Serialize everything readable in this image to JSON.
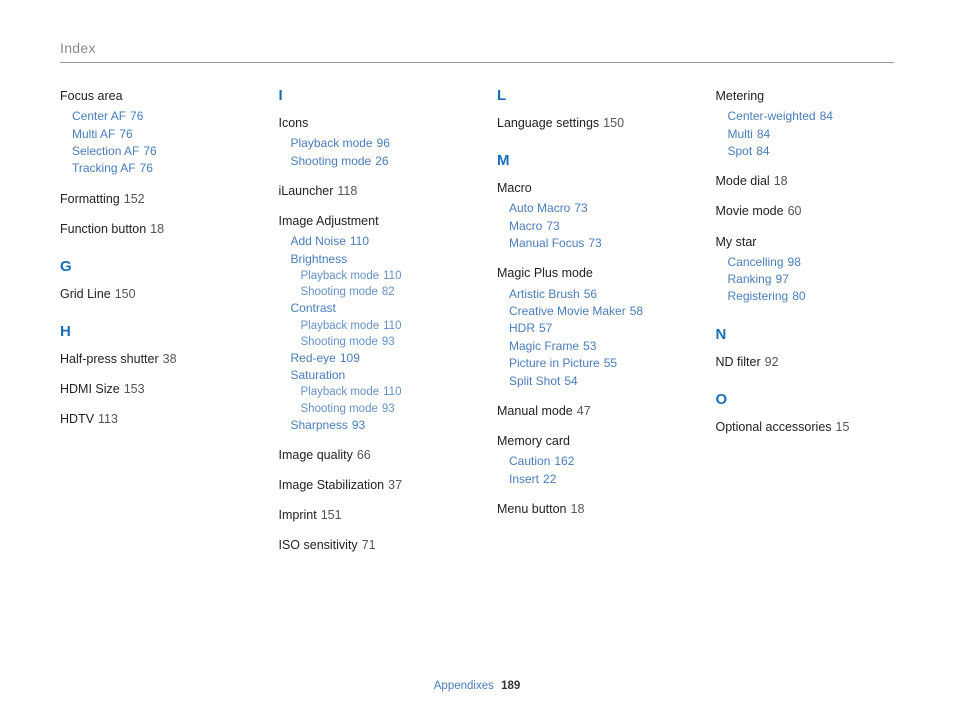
{
  "header": "Index",
  "footer": {
    "label": "Appendixes",
    "page": "189"
  },
  "columns": [
    {
      "items": [
        {
          "type": "entry",
          "title": "Focus area",
          "subs": [
            {
              "label": "Center AF",
              "page": "76"
            },
            {
              "label": "Multi AF",
              "page": "76"
            },
            {
              "label": "Selection AF",
              "page": "76"
            },
            {
              "label": "Tracking AF",
              "page": "76"
            }
          ]
        },
        {
          "type": "entry",
          "title": "Formatting",
          "page": "152"
        },
        {
          "type": "entry",
          "title": "Function button",
          "page": "18"
        },
        {
          "type": "letter",
          "label": "G"
        },
        {
          "type": "entry",
          "title": "Grid Line",
          "page": "150"
        },
        {
          "type": "letter",
          "label": "H"
        },
        {
          "type": "entry",
          "title": "Half-press shutter",
          "page": "38"
        },
        {
          "type": "entry",
          "title": "HDMI Size",
          "page": "153"
        },
        {
          "type": "entry",
          "title": "HDTV",
          "page": "113"
        }
      ]
    },
    {
      "items": [
        {
          "type": "letter",
          "label": "I"
        },
        {
          "type": "entry",
          "title": "Icons",
          "subs": [
            {
              "label": "Playback mode",
              "page": "96"
            },
            {
              "label": "Shooting mode",
              "page": "26"
            }
          ]
        },
        {
          "type": "entry",
          "title": "iLauncher",
          "page": "118"
        },
        {
          "type": "entry",
          "title": "Image Adjustment",
          "subs": [
            {
              "label": "Add Noise",
              "page": "110"
            },
            {
              "label": "Brightness",
              "subsubs": [
                {
                  "label": "Playback mode",
                  "page": "110"
                },
                {
                  "label": "Shooting mode",
                  "page": "82"
                }
              ]
            },
            {
              "label": "Contrast",
              "subsubs": [
                {
                  "label": "Playback mode",
                  "page": "110"
                },
                {
                  "label": "Shooting mode",
                  "page": "93"
                }
              ]
            },
            {
              "label": "Red-eye",
              "page": "109"
            },
            {
              "label": "Saturation",
              "subsubs": [
                {
                  "label": "Playback mode",
                  "page": "110"
                },
                {
                  "label": "Shooting mode",
                  "page": "93"
                }
              ]
            },
            {
              "label": "Sharpness",
              "page": "93"
            }
          ]
        },
        {
          "type": "entry",
          "title": "Image quality",
          "page": "66"
        },
        {
          "type": "entry",
          "title": "Image Stabilization",
          "page": "37"
        },
        {
          "type": "entry",
          "title": "Imprint",
          "page": "151"
        },
        {
          "type": "entry",
          "title": "ISO sensitivity",
          "page": "71"
        }
      ]
    },
    {
      "items": [
        {
          "type": "letter",
          "label": "L"
        },
        {
          "type": "entry",
          "title": "Language settings",
          "page": "150"
        },
        {
          "type": "letter",
          "label": "M"
        },
        {
          "type": "entry",
          "title": "Macro",
          "subs": [
            {
              "label": "Auto Macro",
              "page": "73"
            },
            {
              "label": "Macro",
              "page": "73"
            },
            {
              "label": "Manual Focus",
              "page": "73"
            }
          ]
        },
        {
          "type": "entry",
          "title": "Magic Plus mode",
          "subs": [
            {
              "label": "Artistic Brush",
              "page": "56"
            },
            {
              "label": "Creative Movie Maker",
              "page": "58"
            },
            {
              "label": "HDR",
              "page": "57"
            },
            {
              "label": "Magic Frame",
              "page": "53"
            },
            {
              "label": "Picture in Picture",
              "page": "55"
            },
            {
              "label": "Split Shot",
              "page": "54"
            }
          ]
        },
        {
          "type": "entry",
          "title": "Manual mode",
          "page": "47"
        },
        {
          "type": "entry",
          "title": "Memory card",
          "subs": [
            {
              "label": "Caution",
              "page": "162"
            },
            {
              "label": "Insert",
              "page": "22"
            }
          ]
        },
        {
          "type": "entry",
          "title": "Menu button",
          "page": "18"
        }
      ]
    },
    {
      "items": [
        {
          "type": "entry",
          "title": "Metering",
          "subs": [
            {
              "label": "Center-weighted",
              "page": "84"
            },
            {
              "label": "Multi",
              "page": "84"
            },
            {
              "label": "Spot",
              "page": "84"
            }
          ]
        },
        {
          "type": "entry",
          "title": "Mode dial",
          "page": "18"
        },
        {
          "type": "entry",
          "title": "Movie mode",
          "page": "60"
        },
        {
          "type": "entry",
          "title": "My star",
          "subs": [
            {
              "label": "Cancelling",
              "page": "98"
            },
            {
              "label": "Ranking",
              "page": "97"
            },
            {
              "label": "Registering",
              "page": "80"
            }
          ]
        },
        {
          "type": "letter",
          "label": "N"
        },
        {
          "type": "entry",
          "title": "ND filter",
          "page": "92"
        },
        {
          "type": "letter",
          "label": "O"
        },
        {
          "type": "entry",
          "title": "Optional accessories",
          "page": "15"
        }
      ]
    }
  ]
}
